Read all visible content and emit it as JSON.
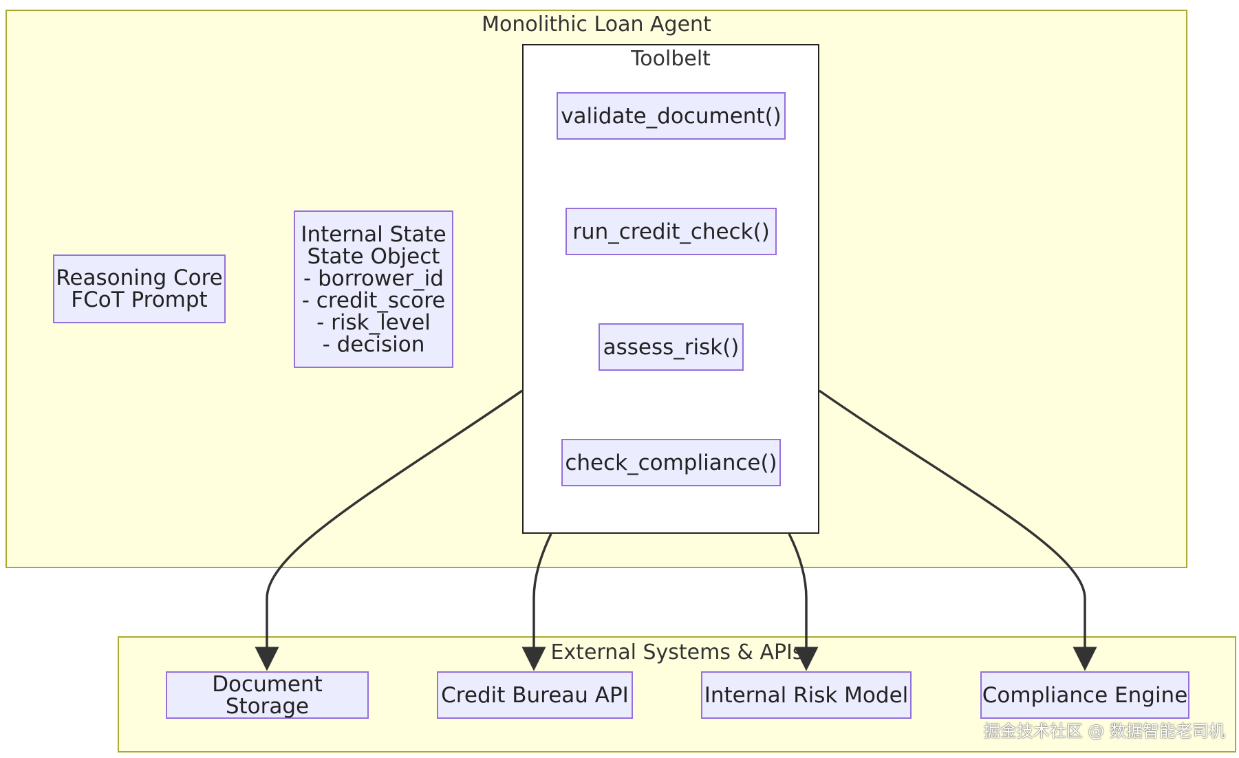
{
  "clusters": {
    "agent": {
      "title": "Monolithic Loan Agent"
    },
    "toolbelt": {
      "title": "Toolbelt"
    },
    "external": {
      "title": "External Systems & APIs"
    }
  },
  "nodes": {
    "reasoning_core": "Reasoning Core\nFCoT Prompt",
    "internal_state": "Internal State\nState Object\n- borrower_id\n- credit_score\n- risk_level\n- decision",
    "validate_document": "validate_document()",
    "run_credit_check": "run_credit_check()",
    "assess_risk": "assess_risk()",
    "check_compliance": "check_compliance()",
    "document_storage": "Document Storage",
    "credit_bureau_api": "Credit Bureau API",
    "internal_risk_model": "Internal Risk Model",
    "compliance_engine": "Compliance Engine"
  },
  "edges": [
    {
      "from": "Toolbelt",
      "to": "Document Storage"
    },
    {
      "from": "Toolbelt",
      "to": "Credit Bureau API"
    },
    {
      "from": "Toolbelt",
      "to": "Internal Risk Model"
    },
    {
      "from": "Toolbelt",
      "to": "Compliance Engine"
    }
  ],
  "colors": {
    "cluster_fill": "#ffffde",
    "cluster_border": "#aaaa33",
    "node_fill": "#ececff",
    "node_border": "#9370db",
    "edge": "#333333"
  },
  "watermark": "掘金技术社区 @ 数据智能老司机"
}
